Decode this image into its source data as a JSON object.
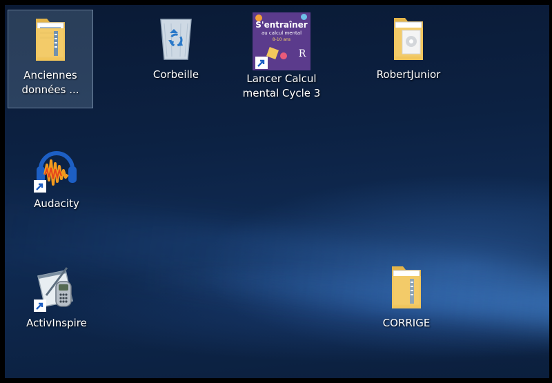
{
  "desktop": {
    "icons": [
      {
        "name": "folder-icon",
        "label_lines": [
          "Anciennes",
          "données ..."
        ],
        "selected": true
      },
      {
        "name": "recycle-bin-icon",
        "label_lines": [
          "Corbeille"
        ]
      },
      {
        "name": "calcul-mental-app-icon",
        "label_lines": [
          "Lancer Calcul",
          "mental Cycle 3"
        ],
        "app_title_lines": [
          "S'entraîner",
          "au calcul mental",
          "8-10 ans"
        ],
        "app_badge": "R"
      },
      {
        "name": "folder-icon",
        "label_lines": [
          "RobertJunior"
        ]
      },
      {
        "name": "audacity-icon",
        "label_lines": [
          "Audacity"
        ]
      },
      {
        "name": "activinspire-icon",
        "label_lines": [
          "ActivInspire"
        ]
      },
      {
        "name": "folder-icon",
        "label_lines": [
          "CORRIGE"
        ]
      }
    ]
  },
  "colors": {
    "selection_highlight": "#a0bedc",
    "folder_yellow": "#f2c75c",
    "calcul_purple": "#5b3b8c",
    "audacity_orange": "#f29a1e",
    "audacity_blue": "#1d5fc4"
  }
}
